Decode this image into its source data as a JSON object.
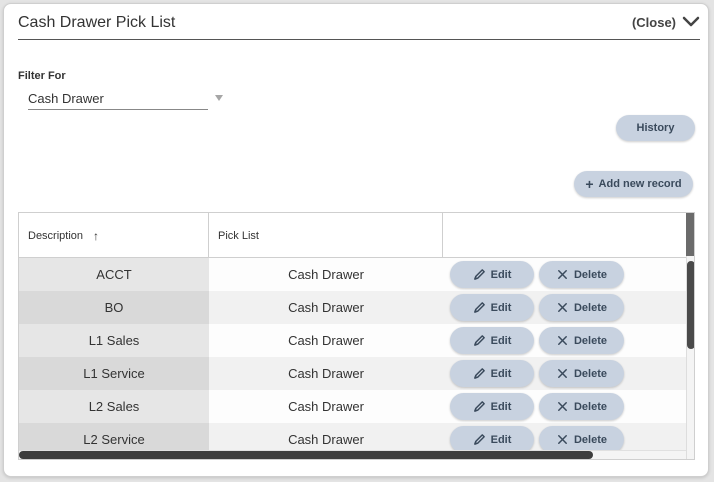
{
  "header": {
    "title": "Cash Drawer Pick List",
    "close_label": "(Close)",
    "chevron_icon": "chevron-down-icon"
  },
  "filter": {
    "label": "Filter For",
    "value": "Cash Drawer"
  },
  "buttons": {
    "history": "History",
    "add_new": "Add new record"
  },
  "table": {
    "columns": [
      "Description",
      "Pick List",
      ""
    ],
    "sort": {
      "column": "Description",
      "direction": "ascending"
    },
    "edit_label": "Edit",
    "delete_label": "Delete",
    "rows": [
      {
        "description": "ACCT",
        "pick_list": "Cash Drawer"
      },
      {
        "description": "BO",
        "pick_list": "Cash Drawer"
      },
      {
        "description": "L1 Sales",
        "pick_list": "Cash Drawer"
      },
      {
        "description": "L1 Service",
        "pick_list": "Cash Drawer"
      },
      {
        "description": "L2 Sales",
        "pick_list": "Cash Drawer"
      },
      {
        "description": "L2 Service",
        "pick_list": "Cash Drawer"
      }
    ]
  },
  "colors": {
    "button_bg": "#c8d2e0",
    "button_text": "#3a4a5c",
    "alt_row": "#f1f1f1",
    "scrollbar": "#3d3d3d"
  }
}
